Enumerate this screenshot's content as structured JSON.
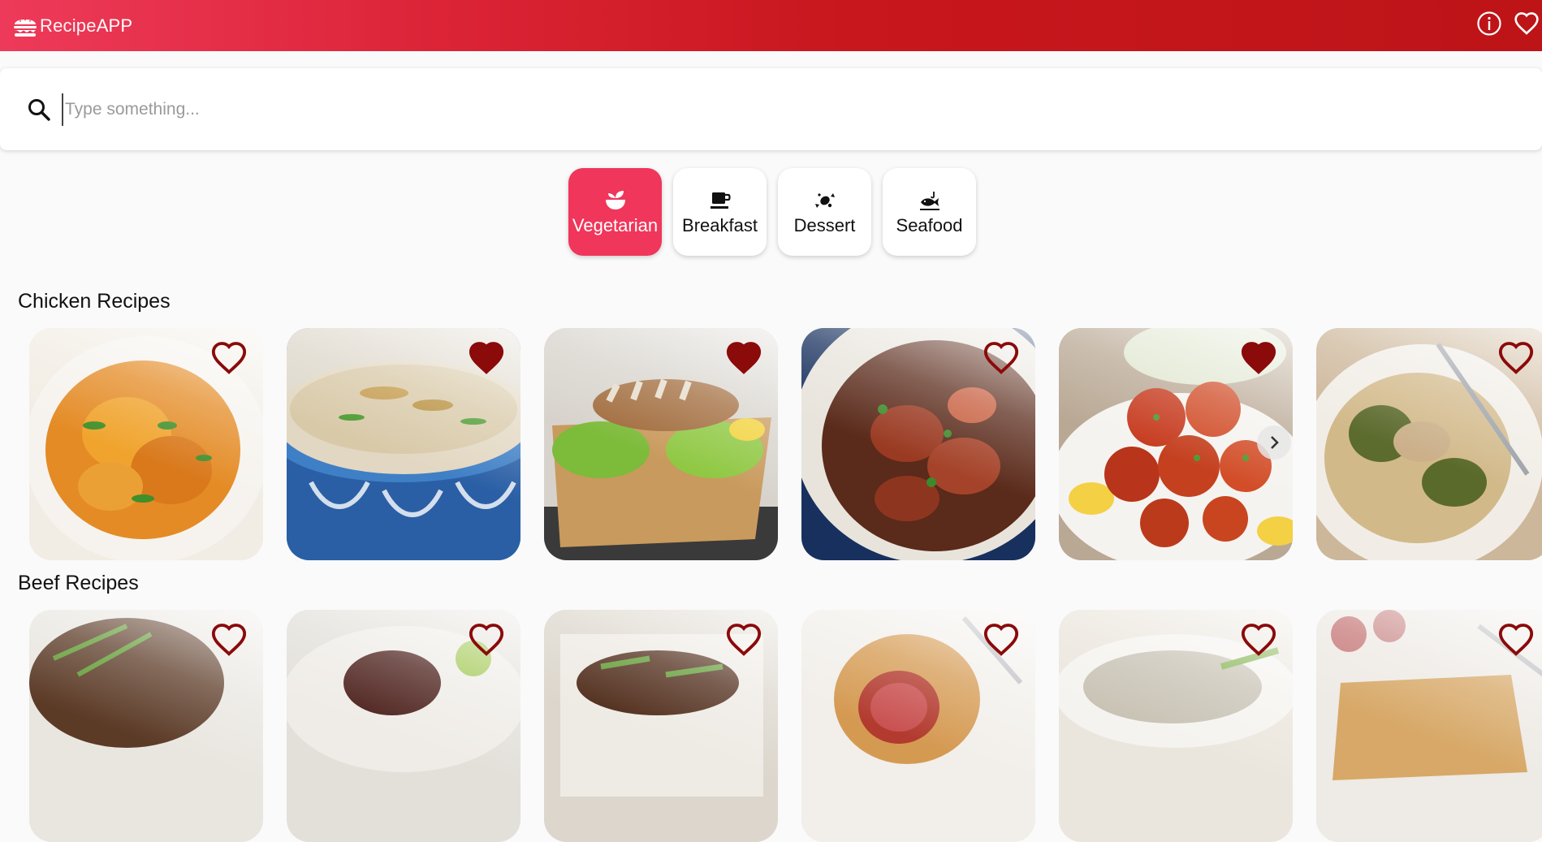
{
  "header": {
    "brand_light": "Recipe",
    "brand_bold": "APP",
    "info_icon": "info-icon",
    "favorites_icon": "heart-outline-icon"
  },
  "search": {
    "placeholder": "Type something...",
    "value": ""
  },
  "categories": [
    {
      "label": "Vegetarian",
      "icon": "bowl-leaf-icon",
      "active": true
    },
    {
      "label": "Breakfast",
      "icon": "coffee-icon",
      "active": false
    },
    {
      "label": "Dessert",
      "icon": "candy-icon",
      "active": false
    },
    {
      "label": "Seafood",
      "icon": "fish-icon",
      "active": false
    }
  ],
  "sections": [
    {
      "title": "Chicken Recipes",
      "favorites": [
        false,
        true,
        true,
        false,
        true,
        false
      ]
    },
    {
      "title": "Beef Recipes",
      "favorites": [
        false,
        false,
        false,
        false,
        false,
        false
      ]
    }
  ],
  "colors": {
    "header_start": "#ee3a5a",
    "header_end": "#bd1418",
    "accent": "#f0365a",
    "heart": "#8b0a0a"
  }
}
